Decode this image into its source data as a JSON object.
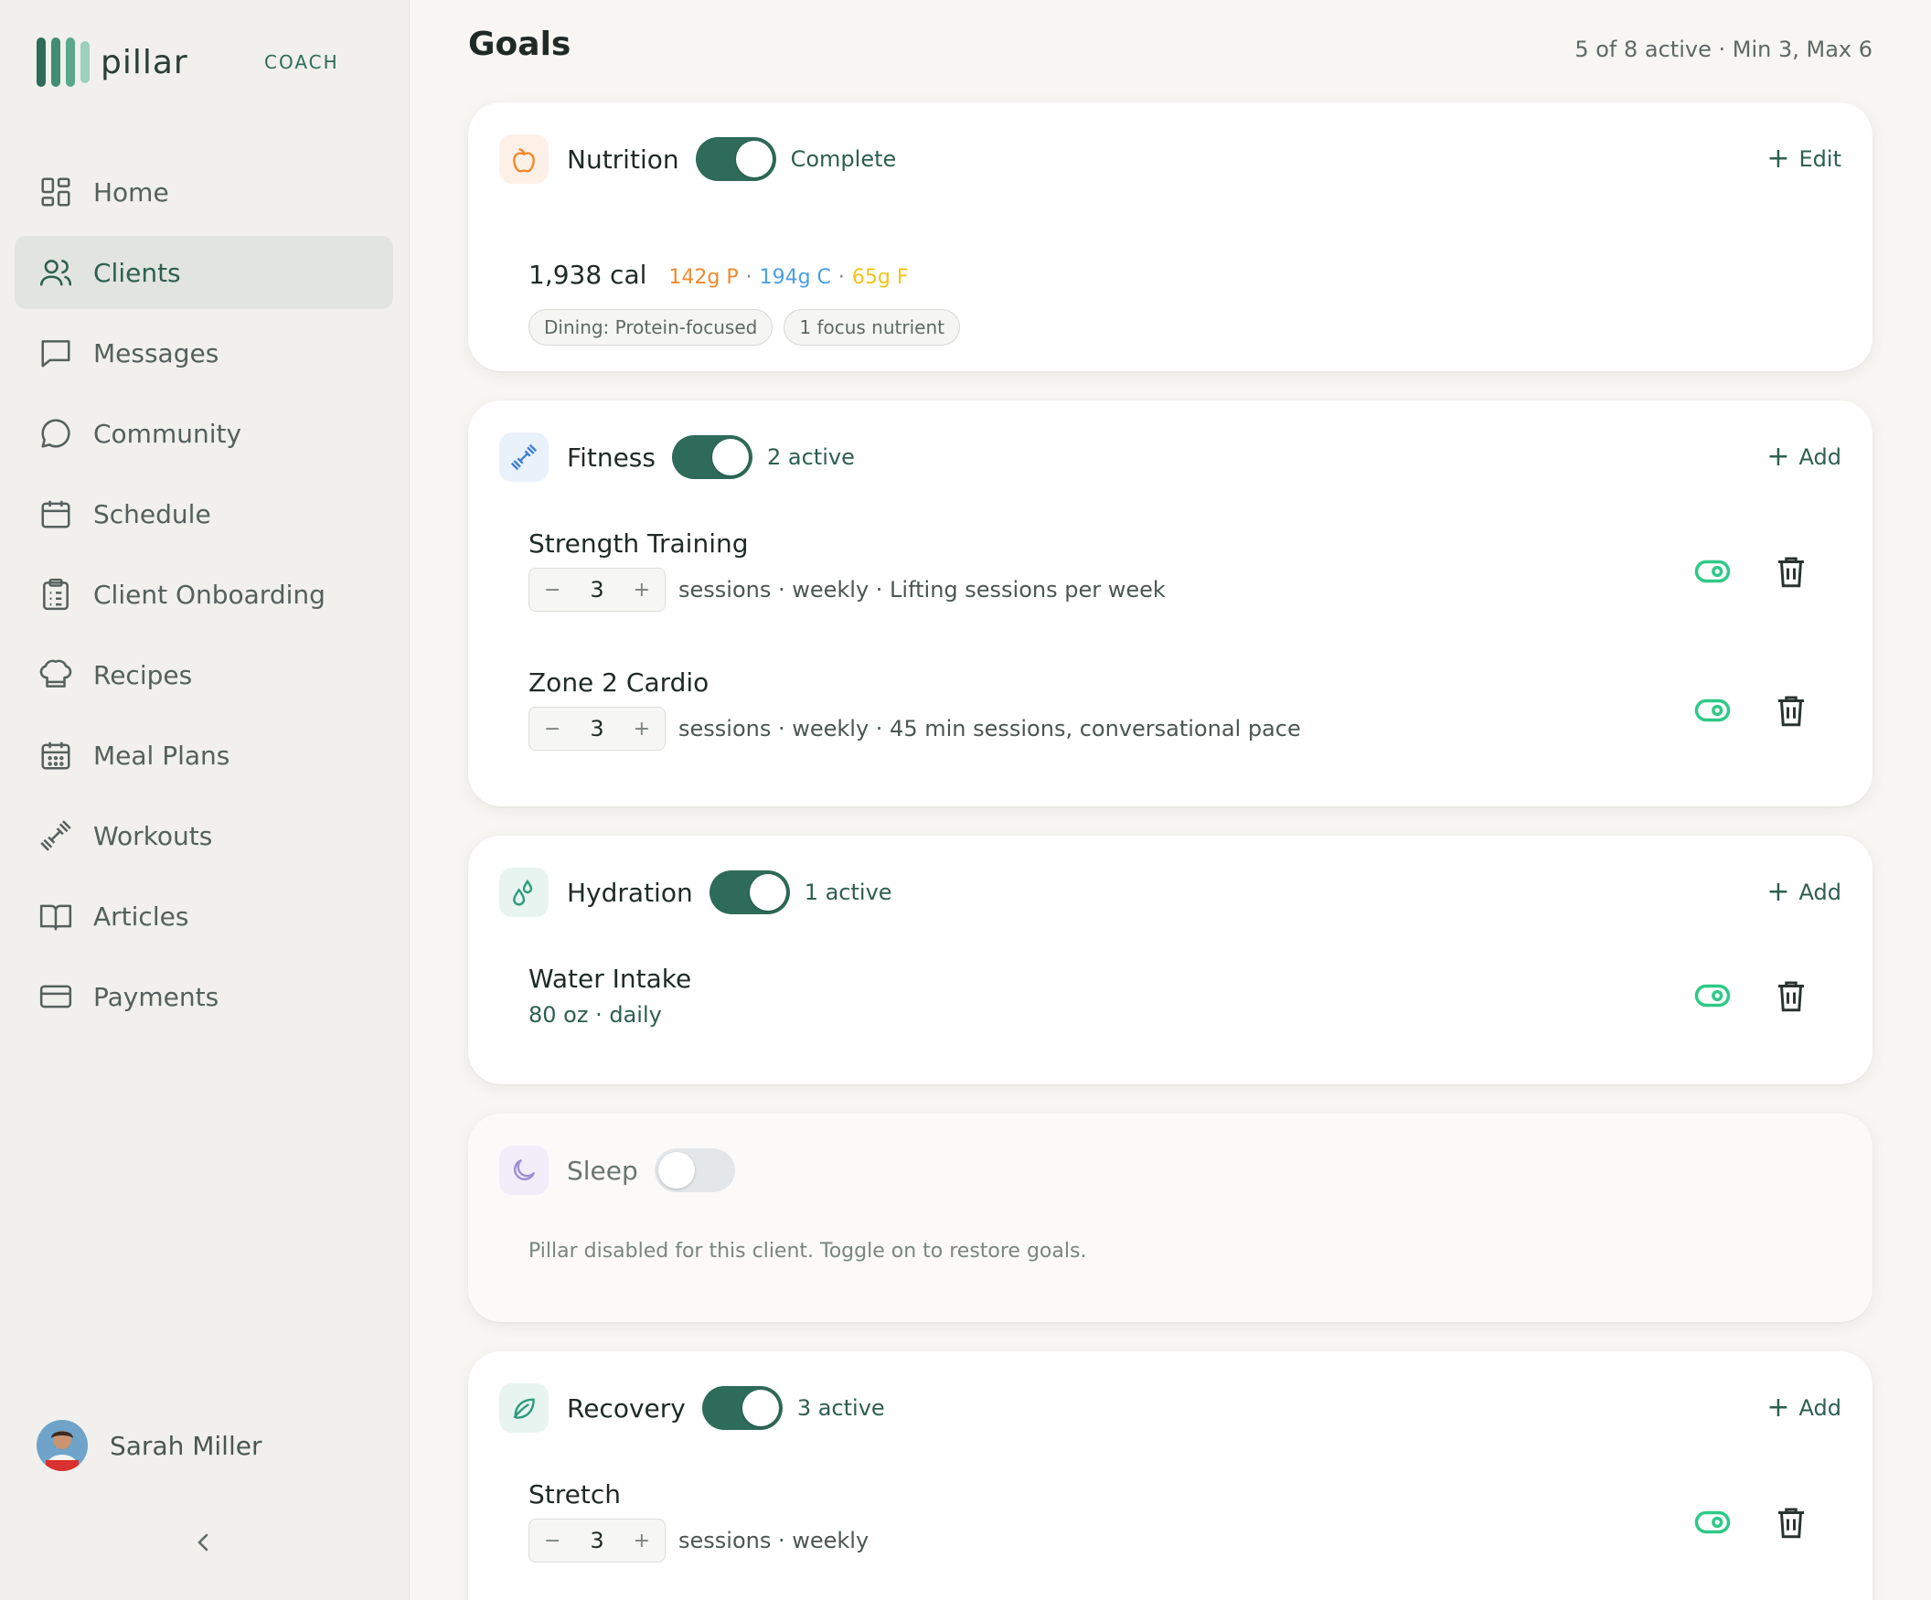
{
  "brand": {
    "name": "pillar",
    "role": "COACH",
    "bar_colors": [
      "#2e6b58",
      "#3f8e73",
      "#5aa88a",
      "#9bd1bd"
    ]
  },
  "nav": [
    {
      "label": "Home",
      "icon": "home-grid-icon",
      "active": false
    },
    {
      "label": "Clients",
      "icon": "users-icon",
      "active": true
    },
    {
      "label": "Messages",
      "icon": "message-square-icon",
      "active": false
    },
    {
      "label": "Community",
      "icon": "chat-bubble-icon",
      "active": false
    },
    {
      "label": "Schedule",
      "icon": "calendar-icon",
      "active": false
    },
    {
      "label": "Client Onboarding",
      "icon": "clipboard-icon",
      "active": false
    },
    {
      "label": "Recipes",
      "icon": "chef-hat-icon",
      "active": false
    },
    {
      "label": "Meal Plans",
      "icon": "calendar-grid-icon",
      "active": false
    },
    {
      "label": "Workouts",
      "icon": "dumbbell-icon",
      "active": false
    },
    {
      "label": "Articles",
      "icon": "book-open-icon",
      "active": false
    },
    {
      "label": "Payments",
      "icon": "credit-card-icon",
      "active": false
    }
  ],
  "user": {
    "name": "Sarah Miller"
  },
  "page": {
    "title": "Goals",
    "summary": "5 of 8 active · Min 3, Max 6"
  },
  "colors": {
    "accent": "#2e6b58",
    "eye": "#2fc987",
    "protein": "#f0892d",
    "carbs": "#4a9ee8",
    "fat": "#f2c31a"
  },
  "nutrition": {
    "name": "Nutrition",
    "enabled": true,
    "status": "Complete",
    "action": "Edit",
    "calories": "1,938 cal",
    "protein": "142g P",
    "carbs": "194g C",
    "fat": "65g F",
    "chips": [
      "Dining: Protein-focused",
      "1 focus nutrient"
    ]
  },
  "fitness": {
    "name": "Fitness",
    "enabled": true,
    "status": "2 active",
    "action": "Add",
    "goals": [
      {
        "name": "Strength Training",
        "value": "3",
        "desc": "sessions · weekly  · Lifting sessions per week"
      },
      {
        "name": "Zone 2 Cardio",
        "value": "3",
        "desc": "sessions · weekly  · 45 min sessions, conversational pace"
      }
    ]
  },
  "hydration": {
    "name": "Hydration",
    "enabled": true,
    "status": "1 active",
    "action": "Add",
    "goals": [
      {
        "name": "Water Intake",
        "desc": "80  oz · daily"
      }
    ]
  },
  "sleep": {
    "name": "Sleep",
    "enabled": false,
    "note": "Pillar disabled for this client. Toggle on to restore goals."
  },
  "recovery": {
    "name": "Recovery",
    "enabled": true,
    "status": "3 active",
    "action": "Add",
    "goals": [
      {
        "name": "Stretch",
        "value": "3",
        "desc": "sessions · weekly"
      }
    ]
  }
}
